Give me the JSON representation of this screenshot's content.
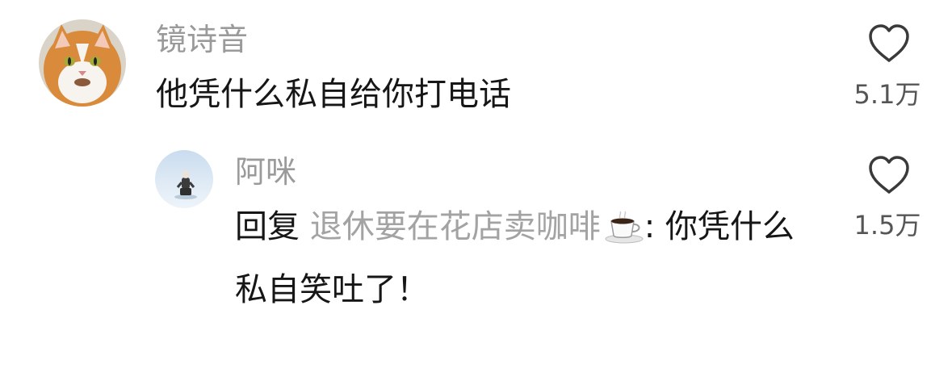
{
  "comments": [
    {
      "username": "镜诗音",
      "text": "他凭什么私自给你打电话",
      "likes": "5.1万",
      "avatar_icon": "cat-avatar"
    }
  ],
  "replies": [
    {
      "username": "阿咪",
      "reply_prefix": "回复",
      "reply_to": "退休要在花店卖咖啡",
      "reply_emoji": "coffee-cup-emoji",
      "separator": ":",
      "text": "你凭什么私自笑吐了！",
      "likes": "1.5万",
      "avatar_icon": "snow-photo-avatar"
    }
  ],
  "colors": {
    "username": "#9a9a9a",
    "text": "#161616",
    "reply_target": "#a3a3a3",
    "like_count": "#555555",
    "icon_stroke": "#3a3a3a"
  }
}
